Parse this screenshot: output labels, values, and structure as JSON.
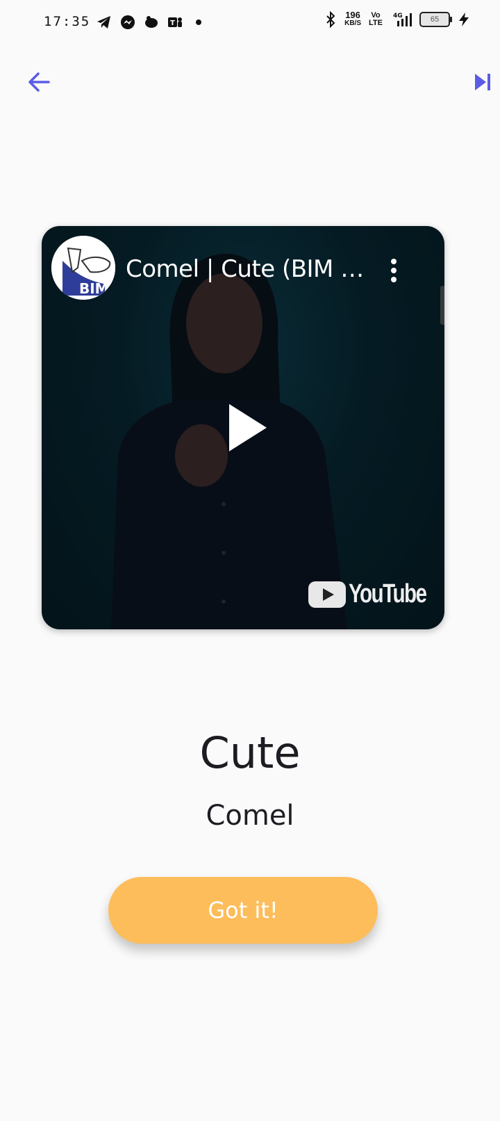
{
  "status_bar": {
    "time": "17:35",
    "net_speed": "196",
    "net_unit": "KB/S",
    "volte": "Vo LTE",
    "network": "4G",
    "battery": "65",
    "left_icons": [
      "telegram-icon",
      "messenger-icon",
      "piggy-icon",
      "teams-icon",
      "dot-icon"
    ],
    "right_icons": [
      "bluetooth-icon",
      "signal-icon",
      "charging-icon"
    ]
  },
  "app_bar": {
    "back_icon": "arrow-left-icon",
    "skip_icon": "skip-next-icon",
    "accent_color": "#5b5ce6"
  },
  "video": {
    "title": "Comel | Cute (BIM B...",
    "channel_logo_text": "BIM",
    "platform": "YouTube",
    "play_icon": "play-icon",
    "more_icon": "more-vertical-icon"
  },
  "word": {
    "english": "Cute",
    "malay": "Comel"
  },
  "actions": {
    "got_it_label": "Got it!",
    "button_color": "#fdbd5a"
  }
}
